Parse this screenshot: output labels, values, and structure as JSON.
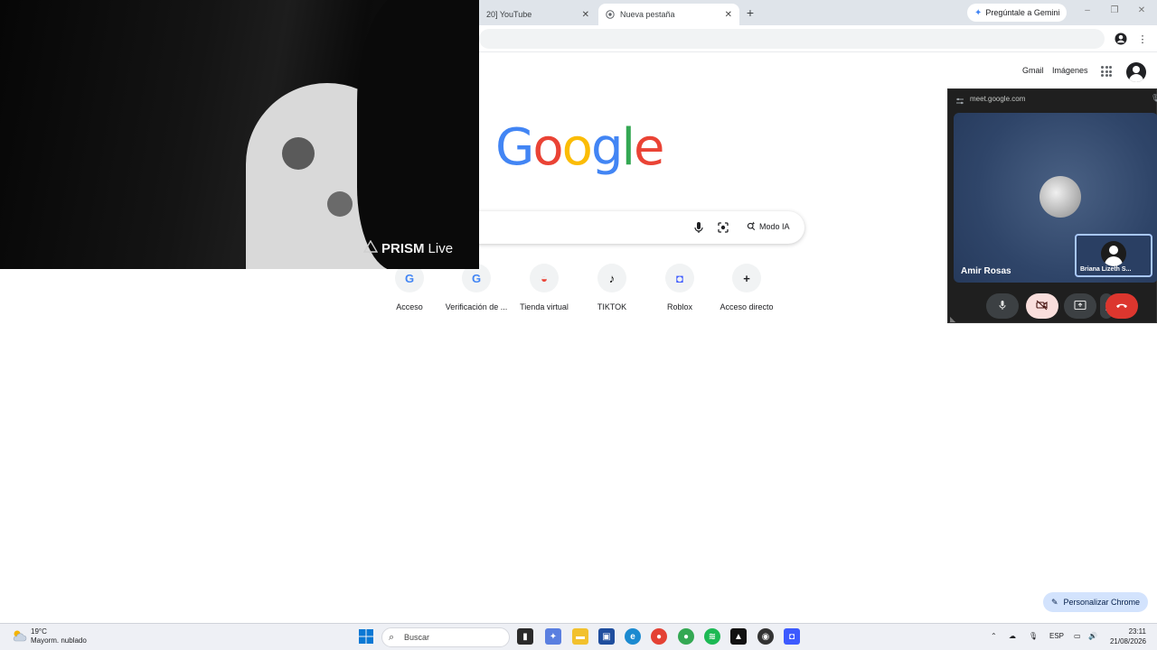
{
  "tabs": [
    {
      "label": "20] YouTube",
      "active": false
    },
    {
      "label": "Nueva pestaña",
      "active": true
    }
  ],
  "tab_close_glyph": "✕",
  "newtab_glyph": "+",
  "gemini_label": "Pregúntale a Gemini",
  "header_links": {
    "gmail": "Gmail",
    "images": "Imágenes"
  },
  "logo_letters": [
    {
      "ch": "G",
      "color": "#4285F4"
    },
    {
      "ch": "o",
      "color": "#EA4335"
    },
    {
      "ch": "o",
      "color": "#FBBC05"
    },
    {
      "ch": "g",
      "color": "#4285F4"
    },
    {
      "ch": "l",
      "color": "#34A853"
    },
    {
      "ch": "e",
      "color": "#EA4335"
    }
  ],
  "search": {
    "ai_mode_label": "Modo IA"
  },
  "shortcuts": [
    {
      "label": "Acceso",
      "icon": "G",
      "color": "#4285F4"
    },
    {
      "label": "Verificación de ...",
      "icon": "G",
      "color": "#4285F4"
    },
    {
      "label": "Tienda virtual",
      "icon": "◒",
      "color": "#EA4335"
    },
    {
      "label": "TIKTOK",
      "icon": "♪",
      "color": "#000000"
    },
    {
      "label": "Roblox",
      "icon": "◘",
      "color": "#3D5AFE"
    },
    {
      "label": "Acceso directo",
      "icon": "+",
      "color": "#202124"
    }
  ],
  "webcam": {
    "brand": "PRISM",
    "brand_suffix": "Live"
  },
  "meet": {
    "url": "meet.google.com",
    "participant_name": "Amir Rosas",
    "self_name": "Briana Lizeth S..."
  },
  "customize_label": "Personalizar Chrome",
  "taskbar": {
    "weather_temp": "19°C",
    "weather_desc": "Mayorm. nublado",
    "search_placeholder": "Buscar",
    "lang": "ESP",
    "time": "23:11",
    "date": "21/08/2026"
  },
  "colors": {
    "accent_blue": "#4285F4",
    "meet_hangup": "#dc362e",
    "meet_cam_off": "#f9dedc",
    "customize_bg": "#d3e3fd"
  }
}
